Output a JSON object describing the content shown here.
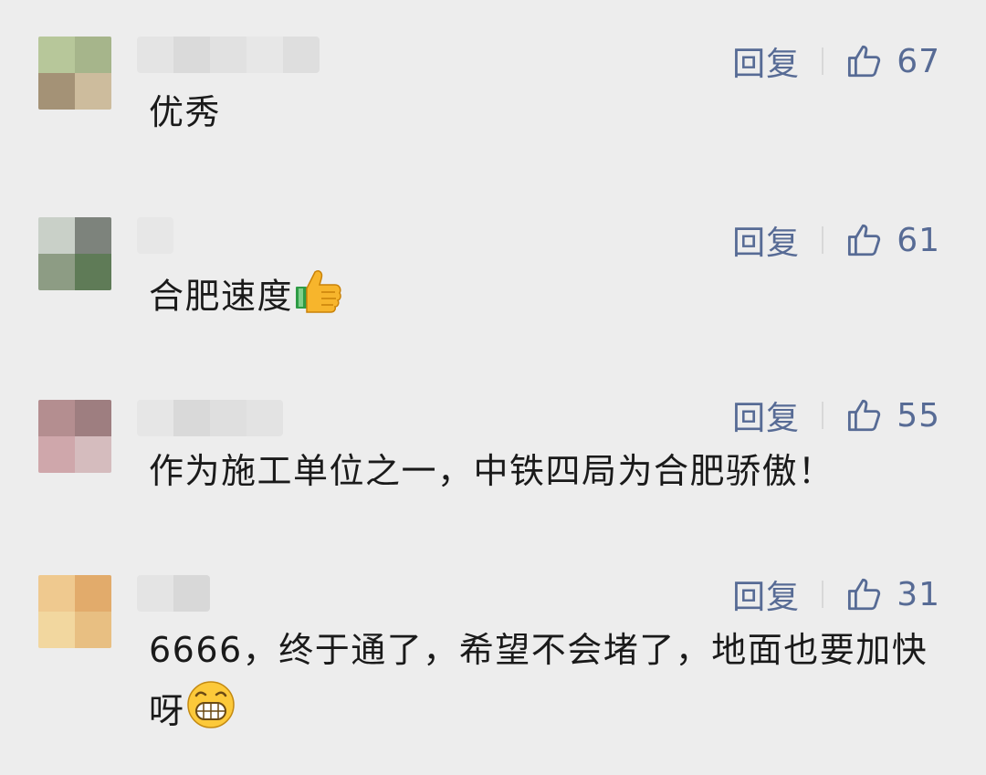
{
  "comments": [
    {
      "reply_label": "回复",
      "like_count": "67",
      "text": "优秀",
      "avatar_colors": [
        "#b7c79a",
        "#a6b58b",
        "#a49276",
        "#cdbc9d"
      ],
      "name_colors": [
        "#e4e4e4",
        "#dadada",
        "#e1e1e1",
        "#e7e7e7",
        "#dedede"
      ]
    },
    {
      "reply_label": "回复",
      "like_count": "61",
      "text": "合肥速度",
      "emoji": "thumbs-up-emoji",
      "avatar_colors": [
        "#c9d0c8",
        "#7d837c",
        "#8d9c84",
        "#5f7b57"
      ],
      "name_colors": [
        "#e7e7e7"
      ]
    },
    {
      "reply_label": "回复",
      "like_count": "55",
      "text": "作为施工单位之一，中铁四局为合肥骄傲！",
      "avatar_colors": [
        "#b48e90",
        "#9e7e80",
        "#cfa7ab",
        "#d5bcbe"
      ],
      "name_colors": [
        "#e6e6e6",
        "#d9d9d9",
        "#dfdfdf",
        "#e3e3e3"
      ]
    },
    {
      "reply_label": "回复",
      "like_count": "31",
      "text": "6666，终于通了，希望不会堵了，地面也要加快呀",
      "emoji": "grinning-face-emoji",
      "avatar_colors": [
        "#efc98f",
        "#e2ab6b",
        "#f2d79f",
        "#e8bf82"
      ],
      "name_colors": [
        "#e4e4e4",
        "#d8d8d8"
      ]
    }
  ]
}
